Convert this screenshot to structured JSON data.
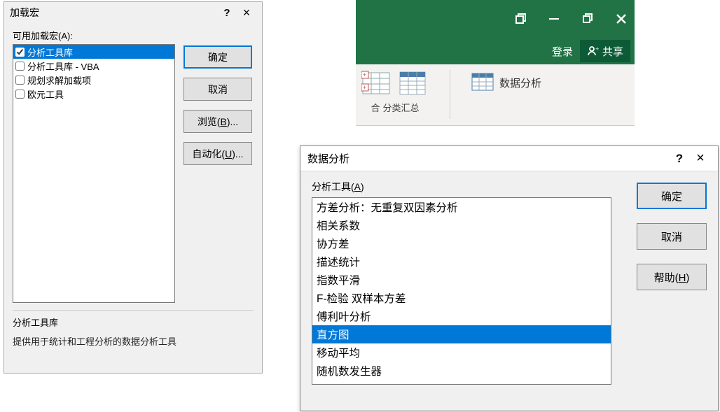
{
  "addins_dialog": {
    "title": "加载宏",
    "available_label": "可用加载宏(A):",
    "items": [
      {
        "label": "分析工具库",
        "checked": true,
        "selected": true
      },
      {
        "label": "分析工具库 - VBA",
        "checked": false,
        "selected": false
      },
      {
        "label": "规划求解加载项",
        "checked": false,
        "selected": false
      },
      {
        "label": "欧元工具",
        "checked": false,
        "selected": false
      }
    ],
    "ok": "确定",
    "cancel": "取消",
    "browse_prefix": "浏览(",
    "browse_key": "B",
    "browse_suffix": ")...",
    "automation_prefix": "自动化(",
    "automation_key": "U",
    "automation_suffix": ")...",
    "desc_name": "分析工具库",
    "desc_text": "提供用于统计和工程分析的数据分析工具"
  },
  "ribbon": {
    "login": "登录",
    "share": "共享",
    "group_label_left": "合",
    "group_label_right": "分类汇总",
    "data_analysis": "数据分析"
  },
  "da_dialog": {
    "title": "数据分析",
    "tools_label_prefix": "分析工具(",
    "tools_label_key": "A",
    "tools_label_suffix": ")",
    "items": [
      "方差分析：无重复双因素分析",
      "相关系数",
      "协方差",
      "描述统计",
      "指数平滑",
      "F-检验 双样本方差",
      "傅利叶分析",
      "直方图",
      "移动平均",
      "随机数发生器"
    ],
    "selected_index": 7,
    "ok": "确定",
    "cancel": "取消",
    "help_prefix": "帮助(",
    "help_key": "H",
    "help_suffix": ")"
  }
}
